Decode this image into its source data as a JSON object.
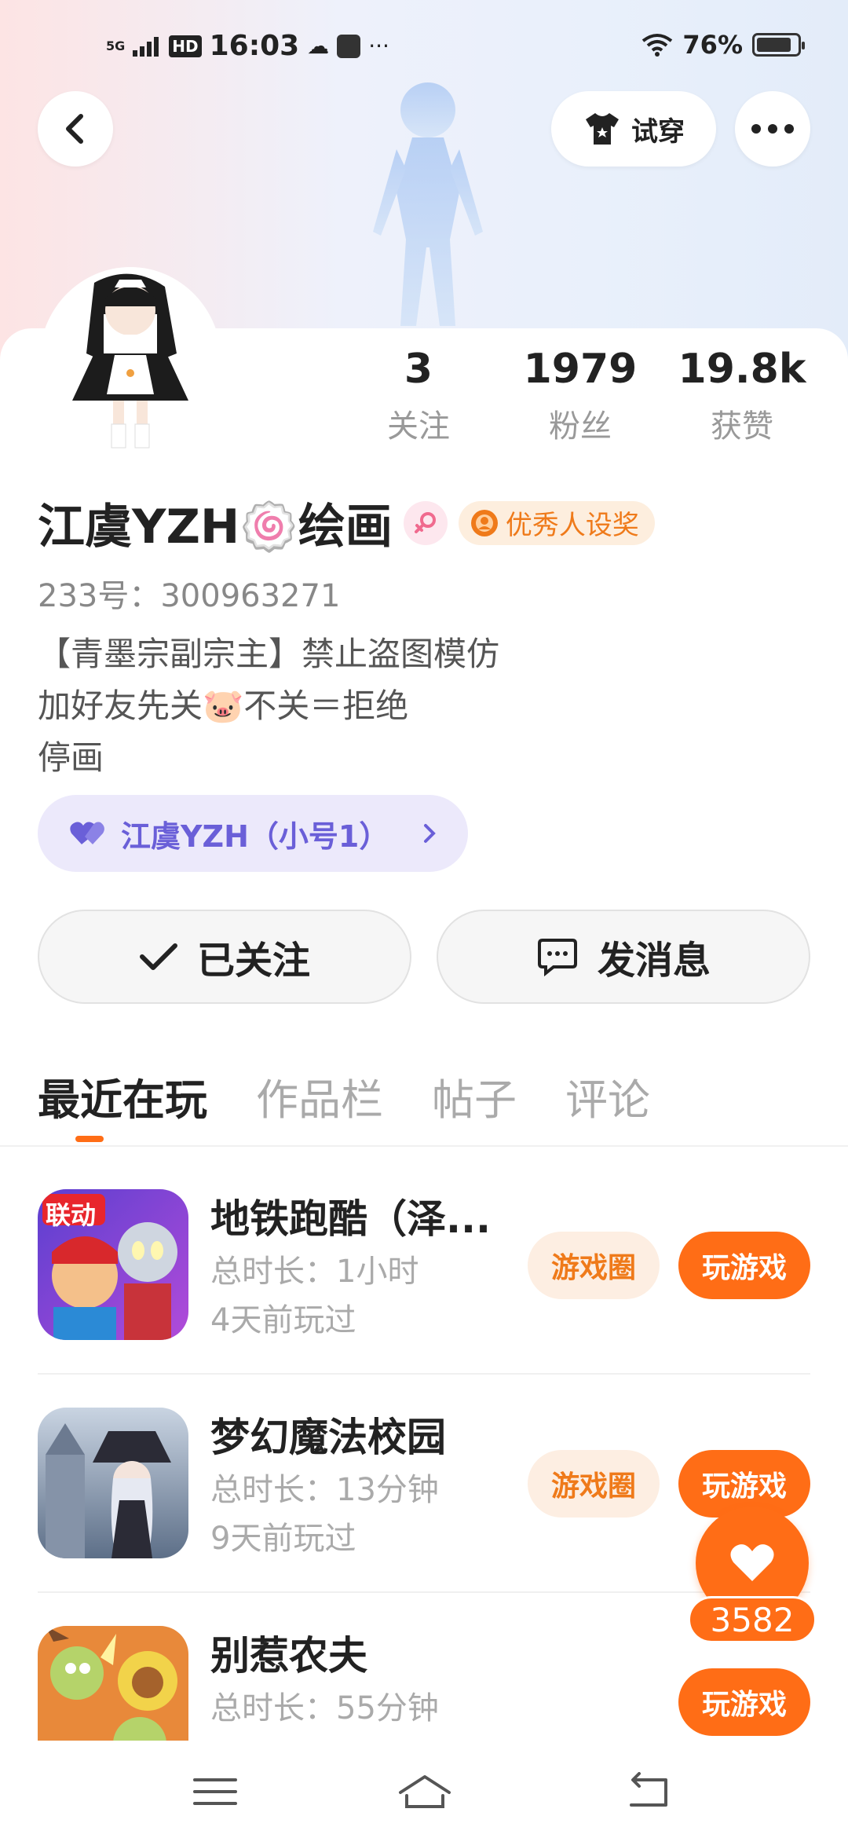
{
  "status_bar": {
    "network": "5G",
    "hd": "HD",
    "time": "16:03",
    "battery_percent": "76%"
  },
  "header": {
    "try_on_label": "试穿"
  },
  "stats": [
    {
      "value": "3",
      "label": "关注"
    },
    {
      "value": "1979",
      "label": "粉丝"
    },
    {
      "value": "19.8k",
      "label": "获赞"
    }
  ],
  "profile": {
    "name": "江虞YZH🍥绘画",
    "award_label": "优秀人设奖",
    "uid": "233号：300963271",
    "bio_lines": [
      "【青墨宗副宗主】禁止盗图模仿",
      "加好友先关🐷不关＝拒绝",
      "停画"
    ],
    "alt_account": "江虞YZH（小号1）"
  },
  "actions": {
    "followed_label": "已关注",
    "message_label": "发消息"
  },
  "tabs": [
    "最近在玩",
    "作品栏",
    "帖子",
    "评论"
  ],
  "games": [
    {
      "title": "地铁跑酷（泽...",
      "total_time": "总时长：1小时",
      "last_played": "4天前玩过",
      "circle_label": "游戏圈",
      "play_label": "玩游戏",
      "badge": "联动"
    },
    {
      "title": "梦幻魔法校园",
      "total_time": "总时长：13分钟",
      "last_played": "9天前玩过",
      "circle_label": "游戏圈",
      "play_label": "玩游戏"
    },
    {
      "title": "别惹农夫",
      "total_time": "总时长：55分钟",
      "last_played": "",
      "circle_label": "",
      "play_label": "玩游戏"
    }
  ],
  "like": {
    "count": "3582"
  },
  "colors": {
    "accent": "#ff6d16",
    "alt_account_bg": "#ece9fb",
    "alt_account_text": "#6a5fd8"
  }
}
